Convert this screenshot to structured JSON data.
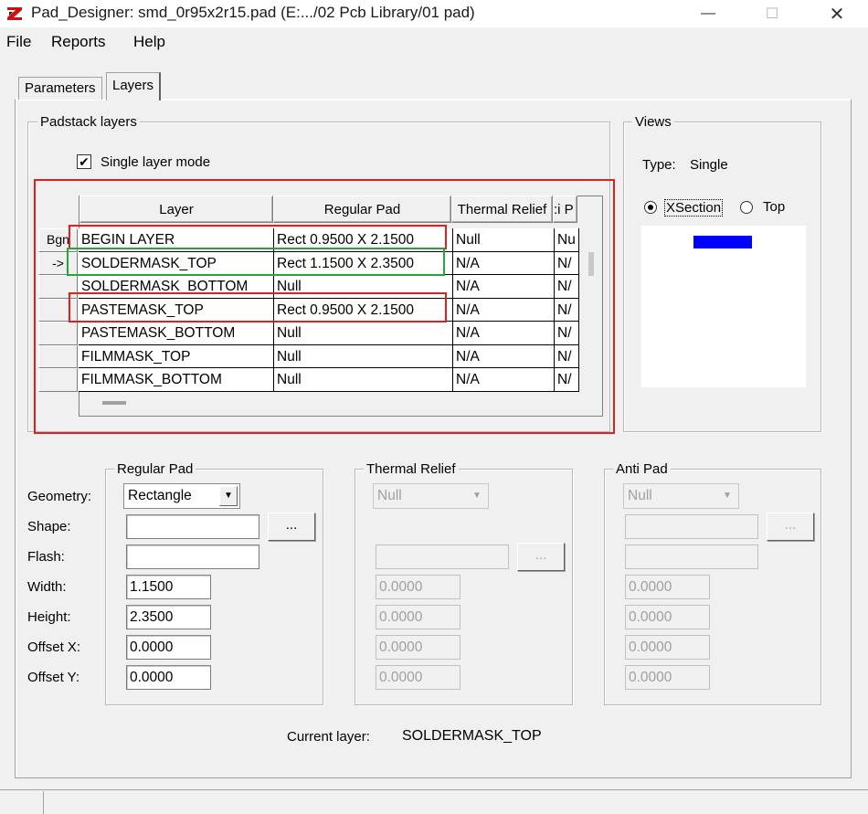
{
  "window": {
    "title": "Pad_Designer: smd_0r95x2r15.pad (E:.../02 Pcb Library/01 pad)",
    "minimize": "—",
    "maximize": "☐",
    "close": "✕"
  },
  "menu": {
    "file": "File",
    "reports": "Reports",
    "help": "Help"
  },
  "tabs": {
    "parameters": "Parameters",
    "layers": "Layers",
    "active": "Layers"
  },
  "padstack": {
    "group_title": "Padstack layers",
    "single_layer_label": "Single layer mode",
    "single_layer_checked": true,
    "columns": [
      "Layer",
      "Regular Pad",
      "Thermal Relief",
      ":i P"
    ],
    "rows": [
      {
        "marker": "Bgn",
        "layer": "BEGIN LAYER",
        "regular": "Rect 0.9500 X 2.1500",
        "thermal": "Null",
        "anti": "Nu"
      },
      {
        "marker": "->",
        "layer": "SOLDERMASK_TOP",
        "regular": "Rect 1.1500 X 2.3500",
        "thermal": "N/A",
        "anti": "N/"
      },
      {
        "marker": "",
        "layer": "SOLDERMASK_BOTTOM",
        "regular": "Null",
        "thermal": "N/A",
        "anti": "N/"
      },
      {
        "marker": "",
        "layer": "PASTEMASK_TOP",
        "regular": "Rect 0.9500 X 2.1500",
        "thermal": "N/A",
        "anti": "N/"
      },
      {
        "marker": "",
        "layer": "PASTEMASK_BOTTOM",
        "regular": "Null",
        "thermal": "N/A",
        "anti": "N/"
      },
      {
        "marker": "",
        "layer": "FILMMASK_TOP",
        "regular": "Null",
        "thermal": "N/A",
        "anti": "N/"
      },
      {
        "marker": "",
        "layer": "FILMMASK_BOTTOM",
        "regular": "Null",
        "thermal": "N/A",
        "anti": "N/"
      }
    ]
  },
  "views": {
    "group_title": "Views",
    "type_label": "Type:",
    "type_value": "Single",
    "xsection_label": "XSection",
    "top_label": "Top",
    "selected": "XSection",
    "pad_color": "#0000ff"
  },
  "labels": {
    "geometry": "Geometry:",
    "shape": "Shape:",
    "flash": "Flash:",
    "width": "Width:",
    "height": "Height:",
    "offset_x": "Offset X:",
    "offset_y": "Offset Y:"
  },
  "regular_pad": {
    "title": "Regular Pad",
    "geometry": "Rectangle",
    "shape": "",
    "flash": "",
    "browse": "...",
    "width": "1.1500",
    "height": "2.3500",
    "offset_x": "0.0000",
    "offset_y": "0.0000"
  },
  "thermal_relief": {
    "title": "Thermal Relief",
    "geometry": "Null",
    "flash": "",
    "browse": "...",
    "width": "0.0000",
    "height": "0.0000",
    "offset_x": "0.0000",
    "offset_y": "0.0000"
  },
  "anti_pad": {
    "title": "Anti Pad",
    "geometry": "Null",
    "shape": "",
    "flash": "",
    "browse": "...",
    "width": "0.0000",
    "height": "0.0000",
    "offset_x": "0.0000",
    "offset_y": "0.0000"
  },
  "current_layer": {
    "label": "Current layer:",
    "value": "SOLDERMASK_TOP"
  },
  "colors": {
    "highlight_red": "#e02020",
    "highlight_green": "#22a836"
  }
}
